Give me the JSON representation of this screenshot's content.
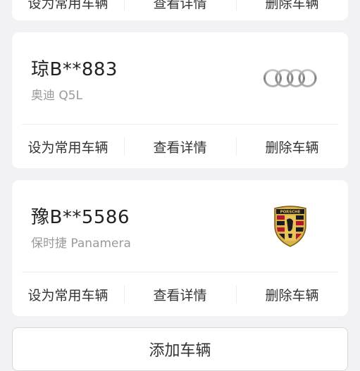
{
  "cards": [
    {
      "actions": [
        "设为常用车辆",
        "查看详情",
        "删除车辆"
      ]
    },
    {
      "plate": "琼B**883",
      "model": "奥迪 Q5L",
      "logo_icon": "audi-rings-logo",
      "actions": [
        "设为常用车辆",
        "查看详情",
        "删除车辆"
      ]
    },
    {
      "plate": "豫B**5586",
      "model": "保时捷 Panamera",
      "logo_icon": "porsche-crest-logo",
      "logo_text": "PORSCHE",
      "actions": [
        "设为常用车辆",
        "查看详情",
        "删除车辆"
      ]
    }
  ],
  "add_button": "添加车辆"
}
